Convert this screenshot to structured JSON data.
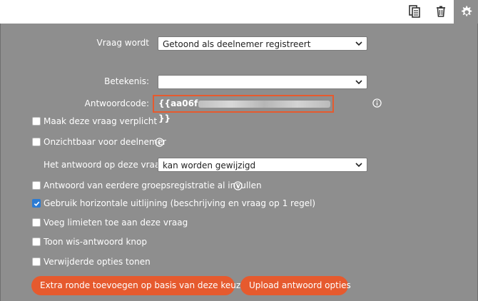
{
  "toolbar": {
    "copy_icon": "copy-icon",
    "trash_icon": "trash-icon",
    "settings_icon": "gear-icon"
  },
  "form": {
    "question_becomes_label": "Vraag wordt",
    "question_becomes_value": "Getoond als deelnemer registreert",
    "meaning_label": "Betekenis:",
    "meaning_value": "",
    "answer_code_label": "Antwoordcode:",
    "answer_code_prefix": "{{aa06f",
    "answer_code_suffix": "}}",
    "answer_editable_label": "Het antwoord op deze vraag",
    "answer_editable_value": "kan worden gewijzigd"
  },
  "checkboxes": [
    {
      "label": "Maak deze vraag verplicht",
      "checked": false
    },
    {
      "label": "Onzichtbaar voor deelnemer",
      "checked": false
    },
    {
      "label": "Antwoord van eerdere groepsregistratie al invullen",
      "checked": false
    },
    {
      "label": "Gebruik horizontale uitlijning (beschrijving en vraag op 1 regel)",
      "checked": true
    },
    {
      "label": "Voeg limieten toe aan deze vraag",
      "checked": false
    },
    {
      "label": "Toon wis-antwoord knop",
      "checked": false
    },
    {
      "label": "Verwijderde opties tonen",
      "checked": false
    }
  ],
  "buttons": {
    "extra_round": "Extra ronde toevoegen op basis van deze keuze(s)",
    "upload_options": "Upload antwoord opties"
  },
  "colors": {
    "panel_bg": "#8e8e8e",
    "accent": "#e65a2e",
    "checkbox_checked": "#2b7bd3"
  }
}
